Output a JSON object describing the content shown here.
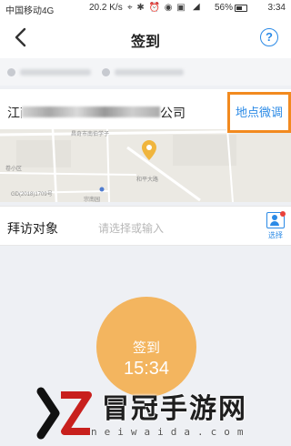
{
  "status_bar": {
    "carrier": "中国移动4G",
    "network_speed": "20.2 K/s",
    "battery": "56%",
    "time": "3:34"
  },
  "nav": {
    "title": "签到",
    "help_symbol": "?"
  },
  "address": {
    "prefix": "江西",
    "suffix": "公司",
    "adjust_location": "地点微调"
  },
  "map": {
    "labels": [
      "昌奇市南伯学子",
      "卷小区",
      "GD(2018)1709号",
      "宗南园",
      "和平大路"
    ]
  },
  "visit": {
    "label": "拜访对象",
    "placeholder": "请选择或输入",
    "select_label": "选择"
  },
  "checkin": {
    "label": "签到",
    "time": "15:34"
  },
  "watermark": {
    "title": "冒冠手游网",
    "url": "neiwaida.com"
  },
  "colors": {
    "accent_blue": "#2b8ae6",
    "highlight_orange": "#f28a1f",
    "checkin_orange": "#f3b55f"
  }
}
